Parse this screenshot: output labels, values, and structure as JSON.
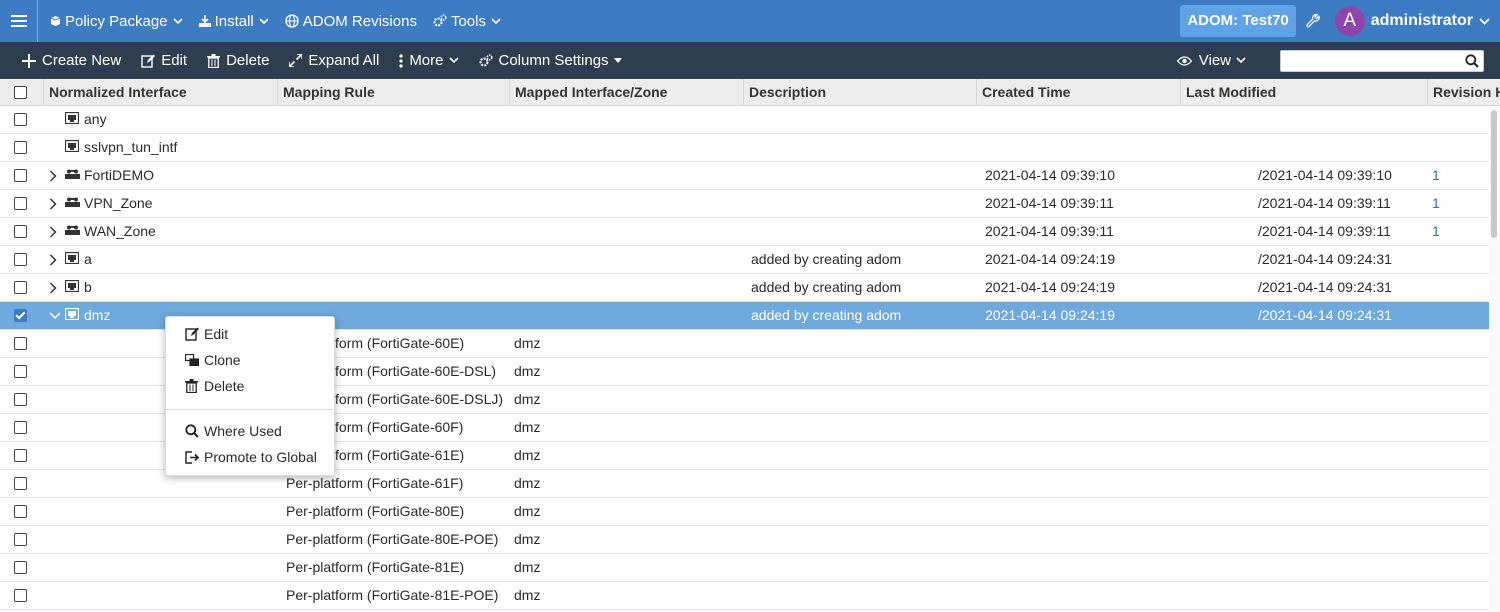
{
  "topbar": {
    "nav": [
      {
        "label": "Policy Package",
        "icon": "package-icon",
        "has_dropdown": true
      },
      {
        "label": "Install",
        "icon": "install-icon",
        "has_dropdown": true
      },
      {
        "label": "ADOM Revisions",
        "icon": "globe-icon",
        "has_dropdown": false
      },
      {
        "label": "Tools",
        "icon": "gears-icon",
        "has_dropdown": true
      }
    ],
    "adom_label": "ADOM: Test70",
    "avatar_letter": "A",
    "username": "administrator"
  },
  "toolbar": {
    "create_new": "Create New",
    "edit": "Edit",
    "delete": "Delete",
    "expand_all": "Expand All",
    "more": "More",
    "column_settings": "Column Settings",
    "view": "View",
    "search_placeholder": ""
  },
  "columns": [
    "Normalized Interface",
    "Mapping Rule",
    "Mapped Interface/Zone",
    "Description",
    "Created Time",
    "Last Modified",
    "Revision H"
  ],
  "rows": [
    {
      "name": "any",
      "type": "interface",
      "expandable": false,
      "mapping": "",
      "mapped": "",
      "description": "",
      "created": "",
      "modified": "",
      "revision": ""
    },
    {
      "name": "sslvpn_tun_intf",
      "type": "interface",
      "expandable": false,
      "mapping": "",
      "mapped": "",
      "description": "",
      "created": "",
      "modified": "",
      "revision": ""
    },
    {
      "name": "FortiDEMO",
      "type": "zone",
      "expandable": true,
      "mapping": "",
      "mapped": "",
      "description": "",
      "created": "2021-04-14 09:39:10",
      "modified": "/2021-04-14 09:39:10",
      "revision": "1"
    },
    {
      "name": "VPN_Zone",
      "type": "zone",
      "expandable": true,
      "mapping": "",
      "mapped": "",
      "description": "",
      "created": "2021-04-14 09:39:11",
      "modified": "/2021-04-14 09:39:11",
      "revision": "1"
    },
    {
      "name": "WAN_Zone",
      "type": "zone",
      "expandable": true,
      "mapping": "",
      "mapped": "",
      "description": "",
      "created": "2021-04-14 09:39:11",
      "modified": "/2021-04-14 09:39:11",
      "revision": "1"
    },
    {
      "name": "a",
      "type": "interface",
      "expandable": true,
      "mapping": "",
      "mapped": "",
      "description": "added by creating adom",
      "created": "2021-04-14 09:24:19",
      "modified": "/2021-04-14 09:24:31",
      "revision": ""
    },
    {
      "name": "b",
      "type": "interface",
      "expandable": true,
      "mapping": "",
      "mapped": "",
      "description": "added by creating adom",
      "created": "2021-04-14 09:24:19",
      "modified": "/2021-04-14 09:24:31",
      "revision": ""
    },
    {
      "name": "dmz",
      "type": "interface",
      "expandable": true,
      "expanded": true,
      "selected": true,
      "mapping": "",
      "mapped": "",
      "description": "added by creating adom",
      "created": "2021-04-14 09:24:19",
      "modified": "/2021-04-14 09:24:31",
      "revision": ""
    },
    {
      "name": "",
      "sub": true,
      "mapping": "Per-platform (FortiGate-60E)",
      "mapped": "dmz"
    },
    {
      "name": "",
      "sub": true,
      "mapping": "Per-platform (FortiGate-60E-DSL)",
      "mapped": "dmz"
    },
    {
      "name": "",
      "sub": true,
      "mapping": "Per-platform (FortiGate-60E-DSLJ)",
      "mapped": "dmz"
    },
    {
      "name": "",
      "sub": true,
      "mapping": "Per-platform (FortiGate-60F)",
      "mapped": "dmz"
    },
    {
      "name": "",
      "sub": true,
      "mapping": "Per-platform (FortiGate-61E)",
      "mapped": "dmz"
    },
    {
      "name": "",
      "sub": true,
      "mapping": "Per-platform (FortiGate-61F)",
      "mapped": "dmz"
    },
    {
      "name": "",
      "sub": true,
      "mapping": "Per-platform (FortiGate-80E)",
      "mapped": "dmz"
    },
    {
      "name": "",
      "sub": true,
      "mapping": "Per-platform (FortiGate-80E-POE)",
      "mapped": "dmz"
    },
    {
      "name": "",
      "sub": true,
      "mapping": "Per-platform (FortiGate-81E)",
      "mapped": "dmz"
    },
    {
      "name": "",
      "sub": true,
      "mapping": "Per-platform (FortiGate-81E-POE)",
      "mapped": "dmz"
    }
  ],
  "context_menu": {
    "edit": "Edit",
    "clone": "Clone",
    "delete": "Delete",
    "where_used": "Where Used",
    "promote": "Promote to Global"
  },
  "colors": {
    "topbar": "#3d7cc2",
    "toolbar": "#2f3e4e",
    "selected_row": "#6fa8dc",
    "adom_badge": "#5fa3e6",
    "avatar": "#8e44ad"
  }
}
